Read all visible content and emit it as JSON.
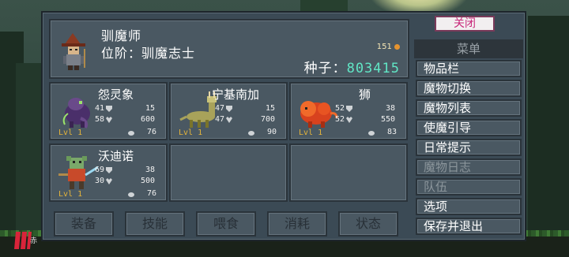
{
  "player": {
    "name": "驯魔师",
    "rank": "位阶：驯魔志士",
    "gold": "151",
    "seed_label": "种子：",
    "seed_value": "803415"
  },
  "monsters": [
    {
      "name": "怨灵象",
      "atk": "41",
      "def": "15",
      "mag": "58",
      "hp": "600",
      "food": "76",
      "level": "Lvl 1"
    },
    {
      "name": "宁基南加",
      "atk": "47",
      "def": "15",
      "mag": "47",
      "hp": "700",
      "food": "90",
      "level": "Lvl 1"
    },
    {
      "name": "狮",
      "atk": "52",
      "def": "38",
      "mag": "52",
      "hp": "550",
      "food": "83",
      "level": "Lvl 1"
    },
    {
      "name": "沃迪诺",
      "atk": "69",
      "def": "38",
      "mag": "30",
      "hp": "500",
      "food": "76",
      "level": "Lvl 1"
    }
  ],
  "buttons": [
    "装备",
    "技能",
    "喂食",
    "消耗",
    "状态"
  ],
  "menu": {
    "close": "关闭",
    "title": "菜单",
    "items": [
      "物品栏",
      "魔物切换",
      "魔物列表",
      "使魔引导",
      "日常提示",
      "魔物日志",
      "队伍",
      "选项",
      "保存并退出"
    ]
  },
  "brand_char": "赤",
  "colors": {
    "seed": "#61e6c5",
    "close_text": "#c8287a",
    "level": "#e5b43a"
  }
}
